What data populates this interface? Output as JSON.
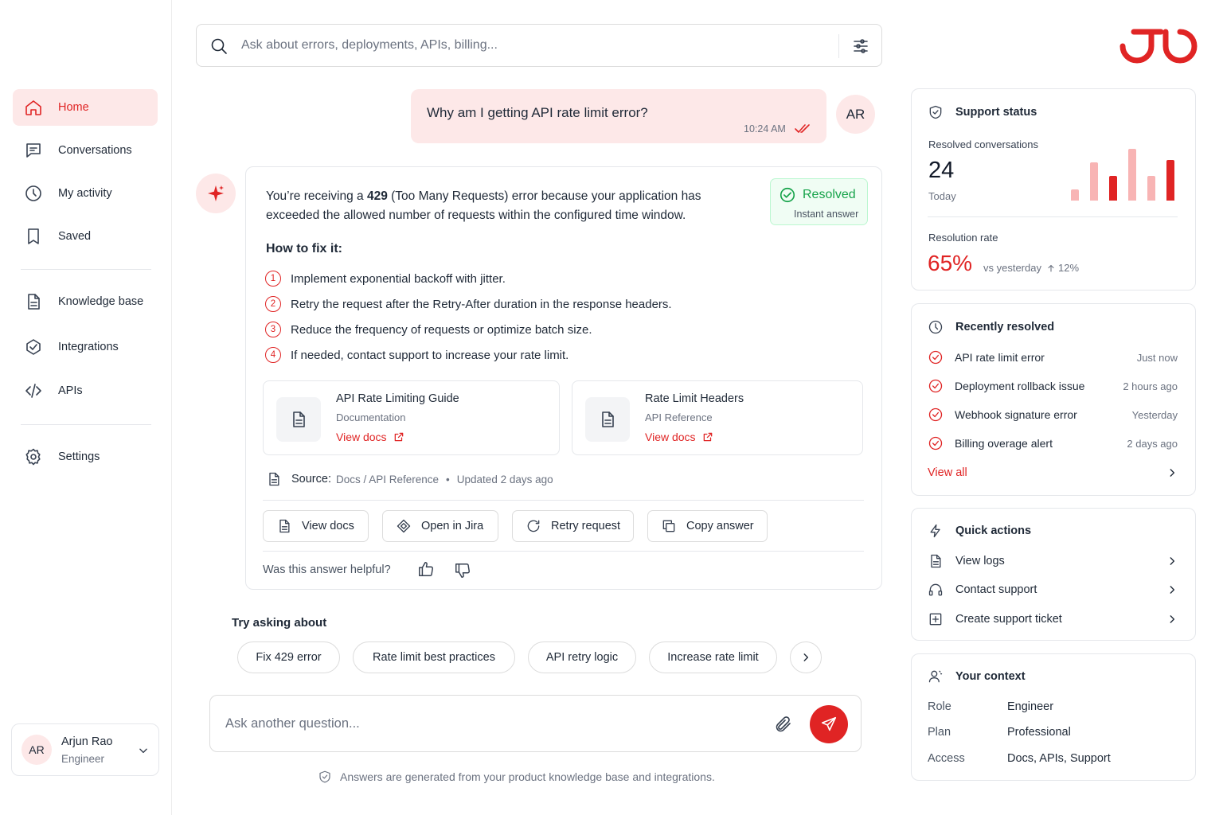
{
  "colors": {
    "accent": "#e02424",
    "accent_soft": "#fde8e8",
    "success": "#16a34a"
  },
  "sidebar": {
    "items": [
      {
        "label": "Home",
        "icon": "home-icon",
        "active": true
      },
      {
        "label": "Conversations",
        "icon": "chat-icon"
      },
      {
        "label": "My activity",
        "icon": "clock-icon"
      },
      {
        "label": "Saved",
        "icon": "bookmark-icon"
      },
      {
        "label": "Knowledge base",
        "icon": "document-icon"
      },
      {
        "label": "Integrations",
        "icon": "integrations-icon"
      },
      {
        "label": "APIs",
        "icon": "code-icon"
      },
      {
        "label": "Settings",
        "icon": "gear-icon"
      }
    ],
    "user": {
      "initials": "AR",
      "name": "Arjun Rao",
      "role": "Engineer"
    }
  },
  "search": {
    "placeholder": "Ask about errors, deployments, APIs, billing..."
  },
  "chat": {
    "question": "Why am I getting API rate limit error?",
    "question_time": "10:24 AM",
    "user_initials": "AR",
    "answer": {
      "intro_pre": "You’re receiving a ",
      "intro_code": "429",
      "intro_post": " (Too Many Requests) error because your application has exceeded the allowed number of requests within the configured time window.",
      "status_label": "Resolved",
      "status_sub": "Instant answer",
      "fix_heading": "How to fix it:",
      "steps": [
        {
          "num": "1",
          "text": "Implement exponential backoff with jitter."
        },
        {
          "num": "2",
          "text": "Retry the request after the Retry-After duration in the response headers."
        },
        {
          "num": "3",
          "text": "Reduce the frequency of requests or optimize batch size."
        },
        {
          "num": "4",
          "text": "If needed, contact support to increase your rate limit."
        }
      ],
      "docs": [
        {
          "title": "API Rate Limiting Guide",
          "subtitle": "Documentation",
          "link": "View docs"
        },
        {
          "title": "Rate Limit Headers",
          "subtitle": "API Reference",
          "link": "View docs"
        }
      ],
      "source_label": "Source:",
      "source_path": "Docs / API Reference",
      "source_updated": "Updated 2 days ago",
      "actions": [
        "View docs",
        "Open in Jira",
        "Retry request",
        "Copy answer"
      ],
      "feedback_prompt": "Was this answer helpful?"
    }
  },
  "suggestions": {
    "heading": "Try asking about",
    "chips": [
      "Fix 429 error",
      "Rate limit best practices",
      "API retry logic",
      "Increase rate limit"
    ]
  },
  "composer": {
    "placeholder": "Ask another question..."
  },
  "footer_note": "Answers are generated from your product knowledge base and integrations.",
  "support_status": {
    "title": "Support status",
    "resolved_label": "Resolved conversations",
    "resolved_count": "24",
    "resolved_period": "Today",
    "rate_label": "Resolution rate",
    "rate_value": "65%",
    "rate_compare": "vs yesterday",
    "rate_delta": "12%",
    "mini_bars": [
      {
        "value": 0.2,
        "tone": "light"
      },
      {
        "value": 0.7,
        "tone": "light"
      },
      {
        "value": 0.45,
        "tone": "dark"
      },
      {
        "value": 0.95,
        "tone": "light"
      },
      {
        "value": 0.45,
        "tone": "light"
      },
      {
        "value": 0.75,
        "tone": "dark"
      }
    ]
  },
  "recently_resolved": {
    "title": "Recently resolved",
    "items": [
      {
        "label": "API rate limit error",
        "when": "Just now"
      },
      {
        "label": "Deployment rollback issue",
        "when": "2 hours ago"
      },
      {
        "label": "Webhook signature error",
        "when": "Yesterday"
      },
      {
        "label": "Billing overage alert",
        "when": "2 days ago"
      }
    ],
    "view_all": "View all"
  },
  "quick_actions": {
    "title": "Quick actions",
    "items": [
      {
        "label": "View logs",
        "icon": "log-icon"
      },
      {
        "label": "Contact support",
        "icon": "headset-icon"
      },
      {
        "label": "Create support ticket",
        "icon": "plus-square-icon"
      }
    ]
  },
  "context": {
    "title": "Your context",
    "rows": [
      {
        "key": "Role",
        "value": "Engineer"
      },
      {
        "key": "Plan",
        "value": "Professional"
      },
      {
        "key": "Access",
        "value": "Docs, APIs, Support"
      }
    ]
  }
}
